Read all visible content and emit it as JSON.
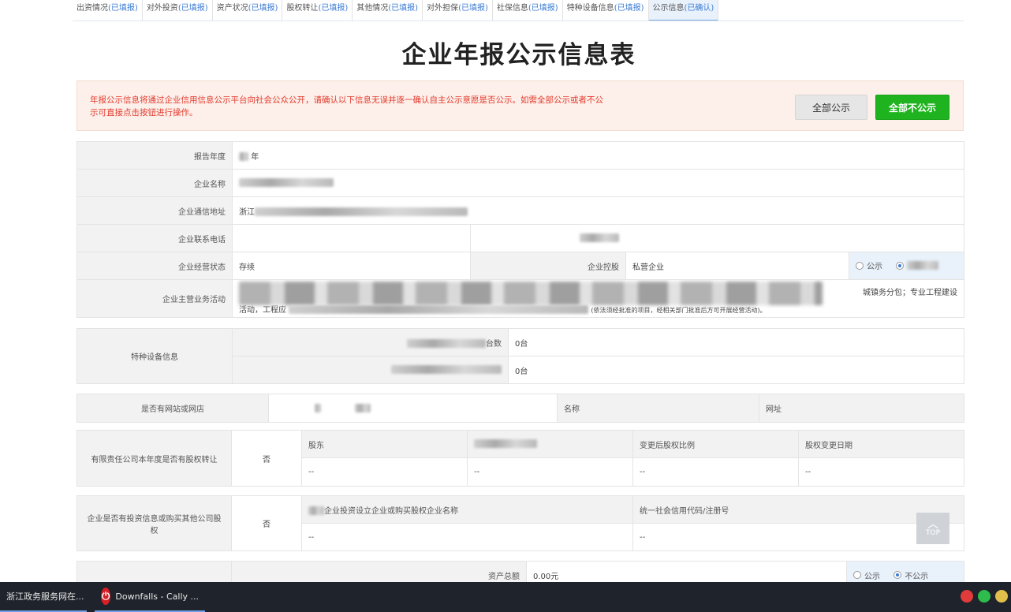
{
  "tabs": [
    {
      "name": "出资情况",
      "status": "(已填报)"
    },
    {
      "name": "对外投资",
      "status": "(已填报)"
    },
    {
      "name": "资产状况",
      "status": "(已填报)"
    },
    {
      "name": "股权转让",
      "status": "(已填报)"
    },
    {
      "name": "其他情况",
      "status": "(已填报)"
    },
    {
      "name": "对外担保",
      "status": "(已填报)"
    },
    {
      "name": "社保信息",
      "status": "(已填报)"
    },
    {
      "name": "特种设备信息",
      "status": "(已填报)"
    },
    {
      "name": "公示信息",
      "status": "(已确认)"
    }
  ],
  "title": "企业年报公示信息表",
  "notice": {
    "text": "年报公示信息将通过企业信用信息公示平台向社会公众公开，请确认以下信息无误并逐一确认自主公示意愿是否公示。如需全部公示或者不公示可直接点击按钮进行操作。",
    "btn_public": "全部公示",
    "btn_nopublic": "全部不公示"
  },
  "basic": {
    "year_label": "报告年度",
    "year_value": "年",
    "name_label": "企业名称",
    "addr_label": "企业通信地址",
    "addr_prefix": "浙江",
    "phone_label": "企业联系电话",
    "status_label": "企业经营状态",
    "status_value": "存续",
    "holding_label": "企业控股",
    "holding_value": "私营企业",
    "business_label": "企业主营业务活动",
    "business_tail": "(依法须经批准的项目，经相关部门批准后方可开展经营活动)。",
    "business_right": "城镇务分包；专业工程建设",
    "business_row2_left": "活动，工程应",
    "public_label": "公示",
    "nopublic_label": "不公示"
  },
  "special": {
    "label": "特种设备信息",
    "row1_suffix": "台数",
    "row1_value": "0台",
    "row2_value": "0台"
  },
  "website": {
    "label": "是否有网站或网店",
    "value": "否",
    "name_col": "名称",
    "url_col": "网址"
  },
  "equity": {
    "label": "有限责任公司本年度是否有股权转让",
    "value": "否",
    "cols": [
      "股东",
      "",
      "变更后股权比例",
      "股权变更日期"
    ],
    "row": [
      "--",
      "--",
      "--",
      "--"
    ]
  },
  "invest": {
    "label": "企业是否有投资信息或购买其他公司股权",
    "value": "否",
    "cols": [
      "企业投资设立企业或购买股权企业名称",
      "统一社会信用代码/注册号"
    ],
    "row": [
      "--",
      "--"
    ]
  },
  "assets": {
    "label": "资产总额",
    "value": "0.00元",
    "public_label": "公示",
    "nopublic_label": "不公示"
  },
  "top_label": "TOP",
  "taskbar": {
    "item1": "浙江政务服务网在...",
    "item2": "Downfalls - Cally ...",
    "net_icon_letter": "⏻"
  }
}
